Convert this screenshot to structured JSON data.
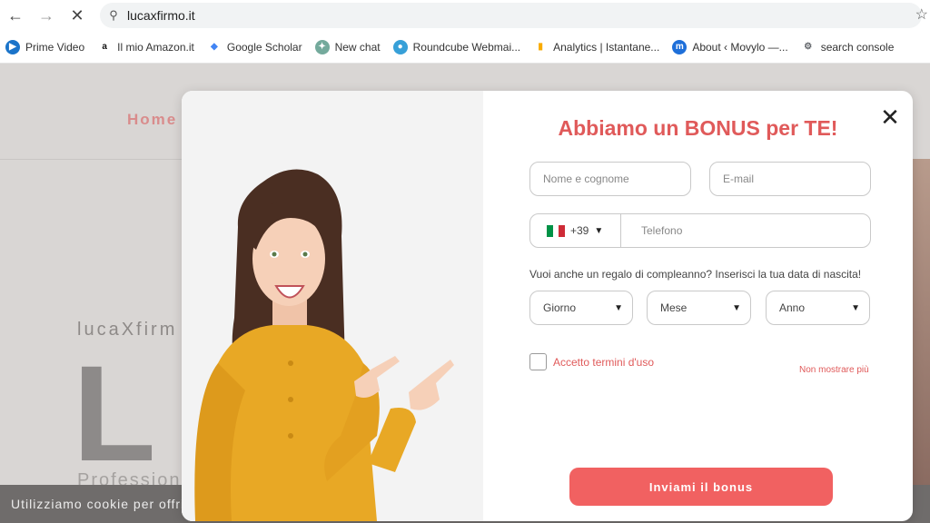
{
  "browser": {
    "url": "lucaxfirmo.it",
    "back_icon": "←",
    "forward_icon": "→",
    "stop_icon": "✕",
    "bookmarks": [
      {
        "label": "Prime Video",
        "icon": "prime-video-icon",
        "color": "#1a73c9",
        "glyph": "▶"
      },
      {
        "label": "Il mio Amazon.it",
        "icon": "amazon-icon",
        "color": "#111111",
        "glyph": "a"
      },
      {
        "label": "Google Scholar",
        "icon": "google-scholar-icon",
        "color": "#4285f4",
        "glyph": "◆"
      },
      {
        "label": "New chat",
        "icon": "chatgpt-icon",
        "color": "#74aa9c",
        "glyph": "✦"
      },
      {
        "label": "Roundcube Webmai...",
        "icon": "roundcube-icon",
        "color": "#37a0d8",
        "glyph": "●"
      },
      {
        "label": "Analytics | Istantane...",
        "icon": "analytics-icon",
        "color": "#f9ab00",
        "glyph": "▮"
      },
      {
        "label": "About ‹ Movylo —...",
        "icon": "movylo-icon",
        "color": "#1e6fd9",
        "glyph": "m"
      },
      {
        "label": "search console",
        "icon": "search-console-icon",
        "color": "#5f6368",
        "glyph": "⚙"
      }
    ]
  },
  "site": {
    "nav_home": "Home",
    "brand": "lucaXfirm",
    "big_letter": "L",
    "profession": "Profession",
    "cookie_text": "Utilizziamo cookie per offrirti"
  },
  "modal": {
    "close_icon": "✕",
    "title": "Abbiamo un BONUS per TE!",
    "name_placeholder": "Nome e cognome",
    "email_placeholder": "E-mail",
    "phone_prefix": "+39",
    "phone_placeholder": "Telefono",
    "birthday_question": "Vuoi anche un regalo di compleanno? Inserisci la tua data di nascita!",
    "day_label": "Giorno",
    "month_label": "Mese",
    "year_label": "Anno",
    "terms_label": "Accetto termini d'uso",
    "no_show_label": "Non mostrare più",
    "submit_label": "Inviami il bonus"
  },
  "colors": {
    "accent": "#e05a5a",
    "button": "#f16161",
    "shirt": "#e8a825"
  }
}
